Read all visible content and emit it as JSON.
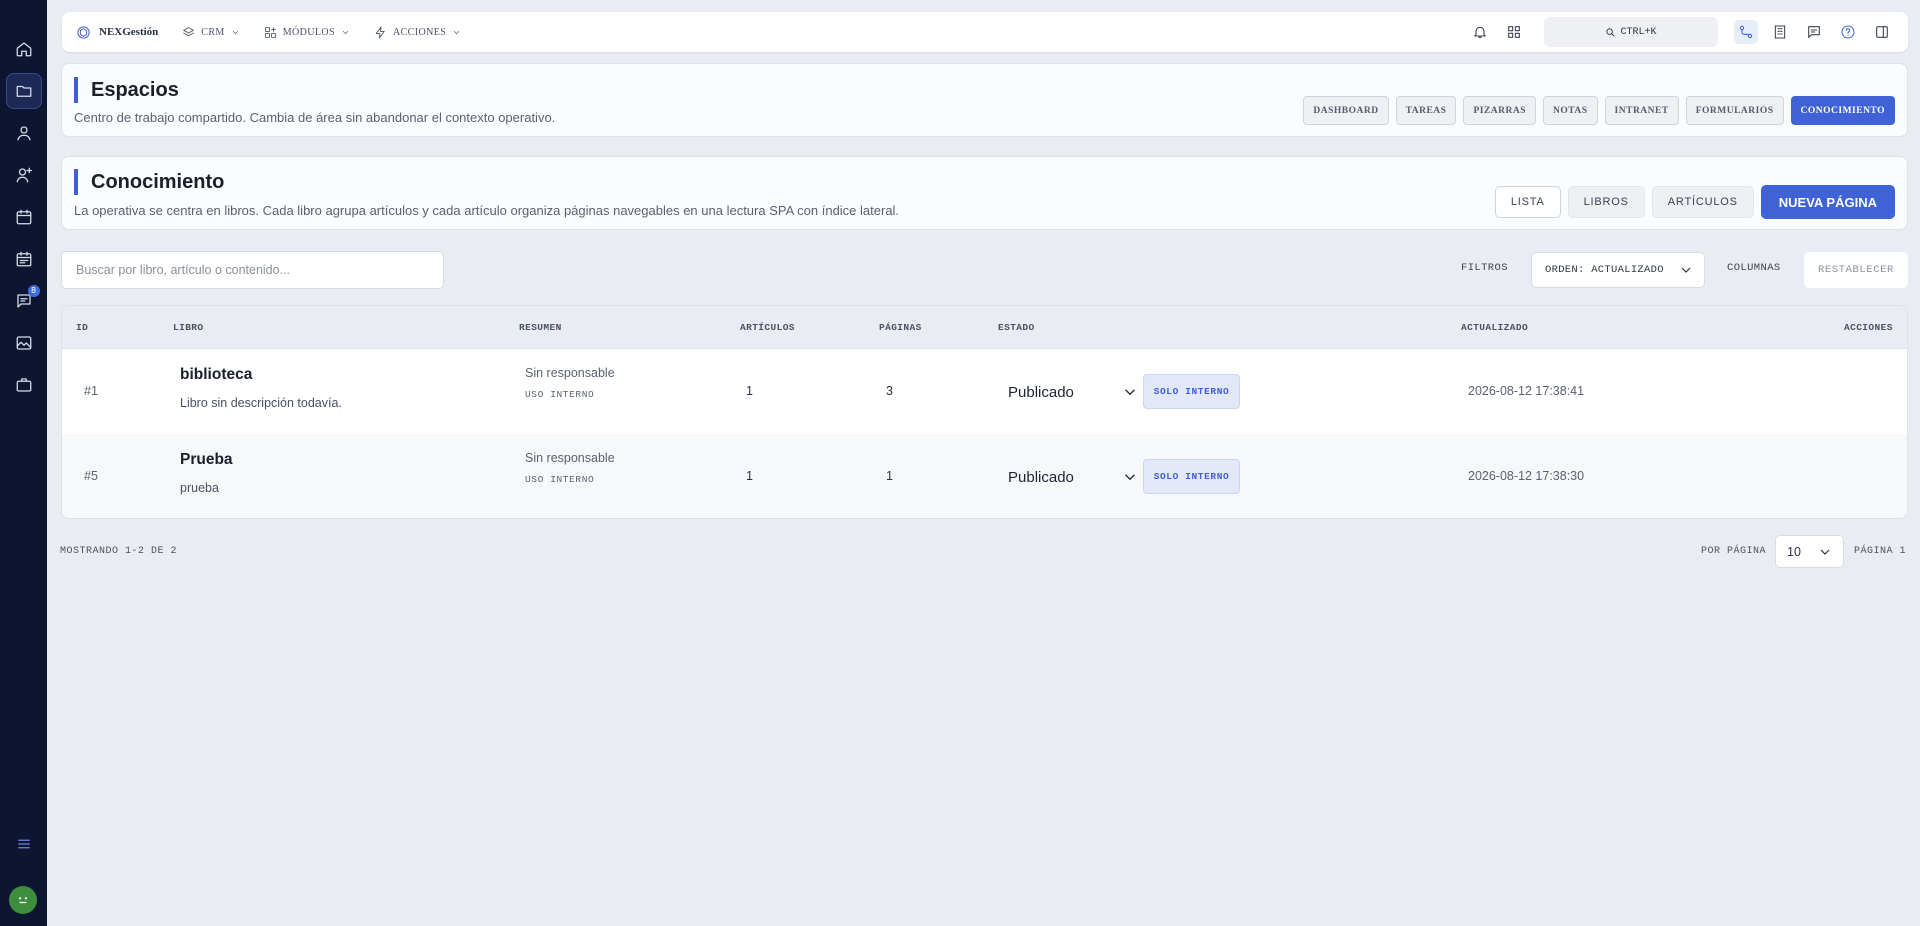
{
  "brand": {
    "name": "NEXGestión"
  },
  "nav": [
    {
      "label": "CRM",
      "icon": "layers-icon"
    },
    {
      "label": "MÓDULOS",
      "icon": "grid-plus-icon"
    },
    {
      "label": "ACCIONES",
      "icon": "bolt-icon"
    }
  ],
  "topbar": {
    "search_label": "CTRL+K"
  },
  "sidebar": {
    "items": [
      "home-icon",
      "folder-icon",
      "user-icon",
      "user-plus-icon",
      "calendar-icon",
      "calendar-check-icon",
      "chat-icon",
      "image-icon",
      "briefcase-icon"
    ],
    "chat_badge": "8",
    "active_index": 1
  },
  "espacios": {
    "title": "Espacios",
    "description": "Centro de trabajo compartido. Cambia de área sin abandonar el contexto operativo.",
    "tabs": [
      "DASHBOARD",
      "TAREAS",
      "PIZARRAS",
      "NOTAS",
      "INTRANET",
      "FORMULARIOS",
      "CONOCIMIENTO"
    ],
    "active_tab": "CONOCIMIENTO"
  },
  "conocimiento": {
    "title": "Conocimiento",
    "description": "La operativa se centra en libros. Cada libro agrupa artículos y cada artículo organiza páginas navegables en una lectura SPA con índice lateral.",
    "views": [
      "LISTA",
      "LIBROS",
      "ARTÍCULOS"
    ],
    "new_page_label": "NUEVA PÁGINA"
  },
  "toolbar": {
    "search_placeholder": "Buscar por libro, artículo o contenido...",
    "filters_label": "FILTROS",
    "order_label": "ORDEN: ACTUALIZADO",
    "columns_label": "COLUMNAS",
    "reset_label": "RESTABLECER"
  },
  "table": {
    "headers": [
      "ID",
      "LIBRO",
      "RESUMEN",
      "ARTÍCULOS",
      "PÁGINAS",
      "ESTADO",
      "ACTUALIZADO",
      "ACCIONES"
    ],
    "rows": [
      {
        "id": "#1",
        "title": "biblioteca",
        "subtitle": "Libro sin descripción todavía.",
        "owner": "Sin responsable",
        "scope": "USO INTERNO",
        "articles": "1",
        "pages": "3",
        "status": "Publicado",
        "badge": "SOLO INTERNO",
        "updated": "2026-08-12 17:38:41"
      },
      {
        "id": "#5",
        "title": "Prueba",
        "subtitle": "prueba",
        "owner": "Sin responsable",
        "scope": "USO INTERNO",
        "articles": "1",
        "pages": "1",
        "status": "Publicado",
        "badge": "SOLO INTERNO",
        "updated": "2026-08-12 17:38:30"
      }
    ]
  },
  "footer": {
    "showing": "MOSTRANDO 1-2 DE 2",
    "per_page_label": "POR PÁGINA",
    "per_page_value": "10",
    "page_label": "PÁGINA 1"
  }
}
